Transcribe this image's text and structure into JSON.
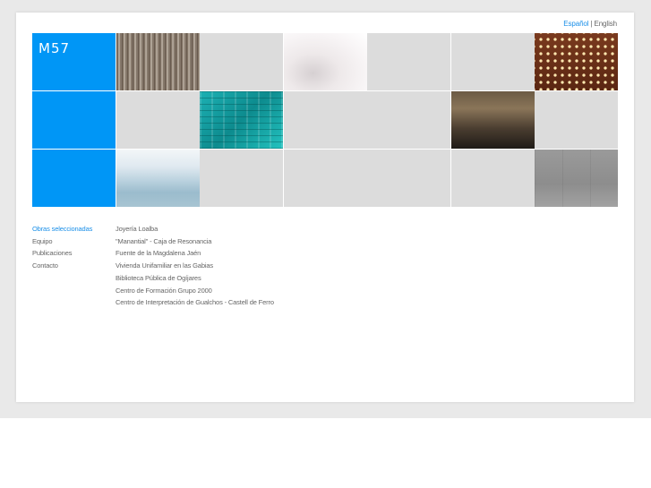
{
  "language": {
    "active": "Español",
    "separator": "|",
    "other": "English"
  },
  "logo": {
    "text": "M57"
  },
  "nav": {
    "items": [
      {
        "label": "Obras seleccionadas",
        "active": true
      },
      {
        "label": "Equipo"
      },
      {
        "label": "Publicaciones"
      },
      {
        "label": "Contacto"
      }
    ]
  },
  "works": {
    "items": [
      "Joyería Loalba",
      "\"Manantial\" - Caja de Resonancia",
      "Fuente de la Magdalena Jaén",
      "Vivienda Unifamiliar en las Gabias",
      "Biblioteca Pública de Ogíjares",
      "Centro de Formación Grupo 2000",
      "Centro de Interpretación de Gualchos - Castell de Ferro"
    ]
  },
  "colors": {
    "accent": "#1a8fe8",
    "tile_blue": "#0096f6",
    "tile_gray": "#dcdcdc",
    "text": "#666666"
  }
}
